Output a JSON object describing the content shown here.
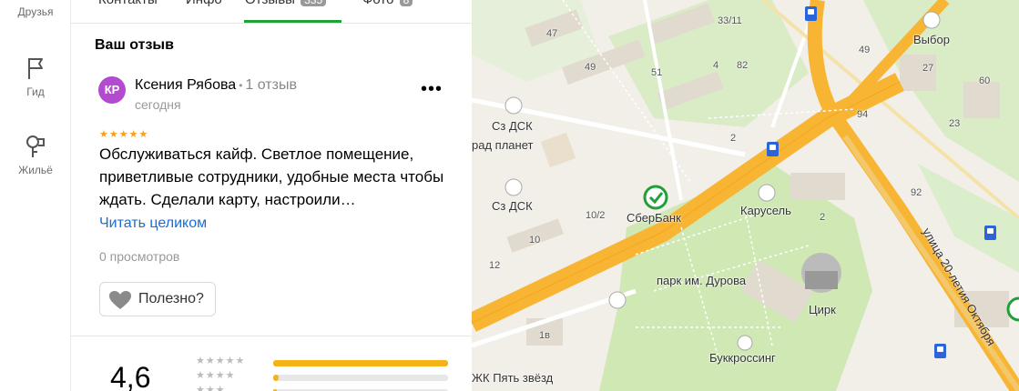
{
  "rail": {
    "items": [
      {
        "label": "Друзья",
        "icon": "friends-icon"
      },
      {
        "label": "Гид",
        "icon": "flag-icon"
      },
      {
        "label": "Жильё",
        "icon": "housing-icon"
      }
    ]
  },
  "tabs": [
    {
      "label": "Контакты"
    },
    {
      "label": "Инфо"
    },
    {
      "label": "Отзывы",
      "count": "335",
      "active": true
    },
    {
      "label": "Фото",
      "count": "8"
    }
  ],
  "review": {
    "section_title": "Ваш отзыв",
    "avatar_initials": "КР",
    "avatar_color": "#b24bd0",
    "author": "Ксения Рябова",
    "author_separator": "•",
    "author_reviews": "1 отзыв",
    "date": "сегодня",
    "rating_stars": 5,
    "text": "Обслуживаться кайф. Светлое помещение, приветливые сотрудники, удобные места чтобы ждать. Сделали карту, настроили…",
    "read_more": "Читать целиком",
    "views": "0 просмотров",
    "helpful": "Полезно?"
  },
  "rating": {
    "value": "4,6",
    "distribution": [
      {
        "stars": 5,
        "fraction": 1.0
      },
      {
        "stars": 4,
        "fraction": 0.03
      },
      {
        "stars": 3,
        "fraction": 0.02
      }
    ]
  },
  "map": {
    "labels": {
      "sber": "СберБанк",
      "sz_dsk_1": "Сз ДСК",
      "sz_dsk_2": "Сз ДСК",
      "grad_planet": "рад планет",
      "karusel": "Карусель",
      "park": "парк им. Дурова",
      "circus": "Цирк",
      "bookcrossing": "Буккроссинг",
      "zhk": "ЖК Пять звёзд",
      "vybor": "Выбор",
      "street": "улица 20-летия Октября"
    },
    "house_numbers": {
      "n47": "47",
      "n49a": "49",
      "n51": "51",
      "n4": "4",
      "n82": "82",
      "n33_11": "33/11",
      "n2a": "2",
      "n10_2": "10/2",
      "n10": "10",
      "n12": "12",
      "n1v": "1в",
      "n2b": "2",
      "n49b": "49",
      "n27": "27",
      "n60": "60",
      "n94": "94",
      "n23": "23",
      "n92": "92"
    },
    "colors": {
      "road": "#f8b533",
      "park": "#cfe8b4",
      "building": "#e3ddd2",
      "accent": "#21a038"
    }
  }
}
